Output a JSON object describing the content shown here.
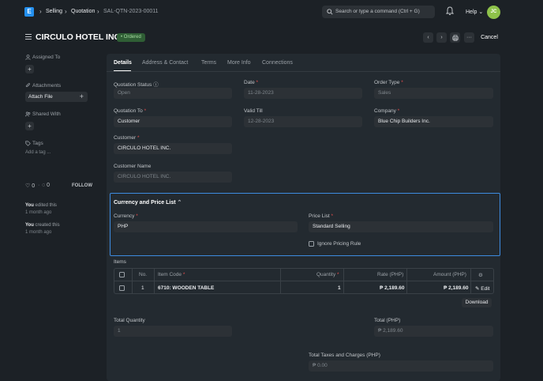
{
  "navbar": {
    "logo": "E",
    "breadcrumbs": [
      "Selling",
      "Quotation",
      "SAL-QTN-2023-00011"
    ],
    "search_placeholder": "Search or type a command (Ctrl + G)",
    "help_label": "Help",
    "avatar_initials": "JC"
  },
  "page": {
    "title": "CIRCULO HOTEL INC.",
    "status_badge": "Ordered",
    "cancel_label": "Cancel"
  },
  "sidebar": {
    "assigned_to": "Assigned To",
    "attachments": "Attachments",
    "attach_file": "Attach File",
    "shared_with": "Shared With",
    "tags": "Tags",
    "add_tag": "Add a tag ...",
    "likes": "0",
    "comments": "0",
    "follow": "FOLLOW",
    "activity": [
      {
        "who": "You",
        "what": " edited this",
        "when": "1 month ago"
      },
      {
        "who": "You",
        "what": " created this",
        "when": "1 month ago"
      }
    ]
  },
  "tabs": [
    "Details",
    "Address & Contact",
    "Terms",
    "More Info",
    "Connections"
  ],
  "form": {
    "quotation_status": {
      "label": "Quotation Status",
      "value": "Open"
    },
    "date": {
      "label": "Date",
      "value": "11-28-2023"
    },
    "order_type": {
      "label": "Order Type",
      "value": "Sales"
    },
    "quotation_to": {
      "label": "Quotation To",
      "value": "Customer"
    },
    "valid_till": {
      "label": "Valid Till",
      "value": "12-28-2023"
    },
    "company": {
      "label": "Company",
      "value": "Blue Chip Builders Inc."
    },
    "customer": {
      "label": "Customer",
      "value": "CIRCULO HOTEL INC."
    },
    "customer_name": {
      "label": "Customer Name",
      "value": "CIRCULO HOTEL INC."
    }
  },
  "currency_section": {
    "title": "Currency and Price List",
    "currency": {
      "label": "Currency",
      "value": "PHP"
    },
    "price_list": {
      "label": "Price List",
      "value": "Standard Selling"
    },
    "ignore_pricing_rule": "Ignore Pricing Rule"
  },
  "items": {
    "label": "Items",
    "columns": [
      "No.",
      "Item Code",
      "Quantity",
      "Rate (PHP)",
      "Amount (PHP)"
    ],
    "rows": [
      {
        "no": "1",
        "item_code": "6710: WOODEN TABLE",
        "quantity": "1",
        "rate": "₱ 2,189.60",
        "amount": "₱ 2,189.60",
        "edit": "Edit"
      }
    ],
    "download": "Download"
  },
  "totals": {
    "total_quantity": {
      "label": "Total Quantity",
      "value": "1"
    },
    "total": {
      "label": "Total (PHP)",
      "value": "₱ 2,189.60"
    },
    "total_taxes": {
      "label": "Total Taxes and Charges (PHP)",
      "value": "₱ 0.00"
    }
  }
}
